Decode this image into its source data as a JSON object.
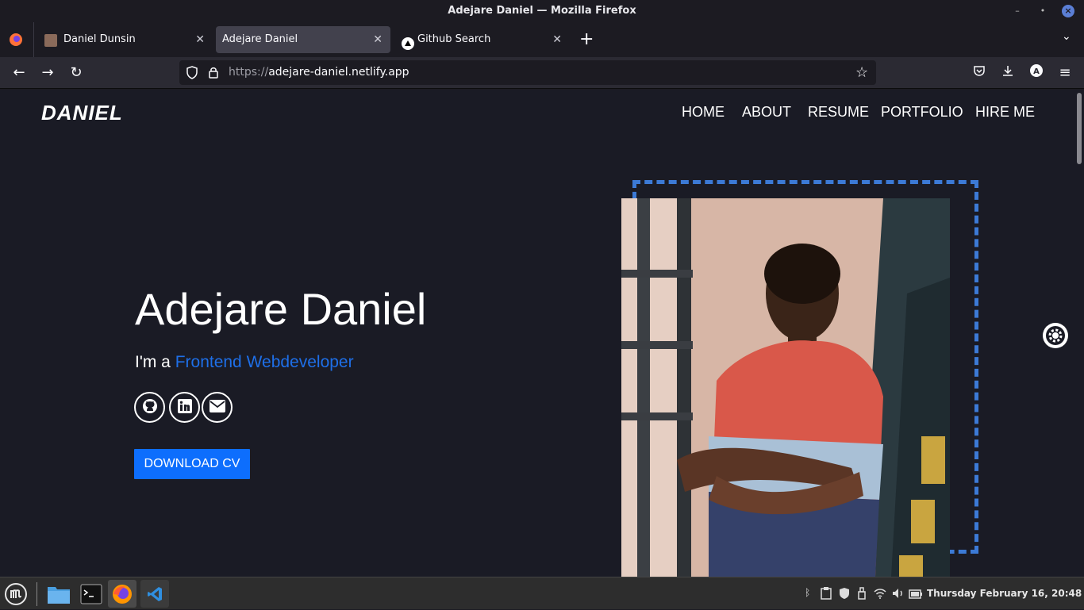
{
  "window": {
    "title": "Adejare Daniel — Mozilla Firefox"
  },
  "tabs": [
    {
      "label": "Daniel Dunsin",
      "active": false
    },
    {
      "label": "Adejare Daniel",
      "active": true
    },
    {
      "label": "Github Search",
      "active": false
    }
  ],
  "urlbar": {
    "scheme": "https://",
    "host": "adejare-daniel.netlify.app"
  },
  "site": {
    "logo": "DANIEL",
    "nav": [
      "HOME",
      "ABOUT",
      "RESUME",
      "PORTFOLIO",
      "HIRE ME"
    ],
    "hero": {
      "name": "Adejare Daniel",
      "intro": "I'm a ",
      "role": "Frontend Webdeveloper",
      "cv_button": "DOWNLOAD CV"
    },
    "social": [
      "github-icon",
      "linkedin-icon",
      "envelope-icon"
    ],
    "colors": {
      "accent": "#0d6efd",
      "frame": "#3c7ad6",
      "background": "#1a1b25"
    }
  },
  "taskbar": {
    "clock": "Thursday February 16, 20:48",
    "apps": [
      "mint-menu",
      "files",
      "terminal",
      "firefox",
      "vscode"
    ]
  }
}
